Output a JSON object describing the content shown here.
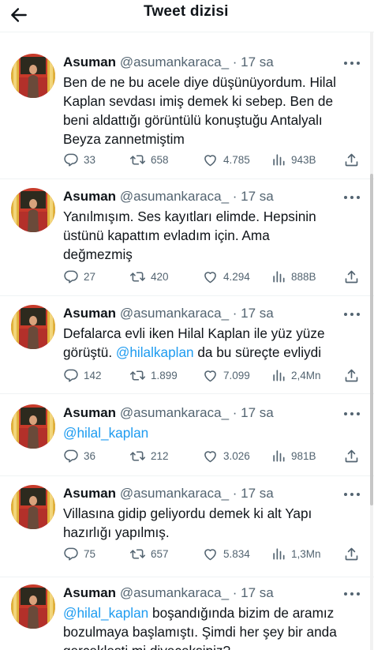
{
  "header": {
    "title": "Tweet dizisi"
  },
  "tweets": [
    {
      "name": "Asuman",
      "handle": "@asumankaraca_",
      "dot": "·",
      "time": "17 sa",
      "lines": [
        "Ben de ne bu acele diye düşünüyordum. Hilal",
        "Kaplan sevdası imiş demek ki sebep. Ben de",
        "beni aldattığı görüntülü konuştuğu Antalyalı",
        "Beyza zannetmiştim"
      ],
      "replies": "33",
      "retweets": "658",
      "likes": "4.785",
      "views": "943B"
    },
    {
      "name": "Asuman",
      "handle": "@asumankaraca_",
      "dot": "·",
      "time": "17 sa",
      "lines": [
        "Yanılmışım. Ses kayıtları elimde. Hepsinin",
        "üstünü kapattım evladım için. Ama",
        "değmezmiş"
      ],
      "replies": "27",
      "retweets": "420",
      "likes": "4.294",
      "views": "888B"
    },
    {
      "name": "Asuman",
      "handle": "@asumankaraca_",
      "dot": "·",
      "time": "17 sa",
      "line1": "Defalarca evli iken Hilal Kaplan ile yüz yüze",
      "line2_before": "görüştü. ",
      "mention": "@hilalkaplan",
      "line2_after": " da bu süreçte evliydi",
      "replies": "142",
      "retweets": "1.899",
      "likes": "7.099",
      "views": "2,4Mn"
    },
    {
      "name": "Asuman",
      "handle": "@asumankaraca_",
      "dot": "·",
      "time": "17 sa",
      "mention": "@hilal_kaplan",
      "replies": "36",
      "retweets": "212",
      "likes": "3.026",
      "views": "981B"
    },
    {
      "name": "Asuman",
      "handle": "@asumankaraca_",
      "dot": "·",
      "time": "17 sa",
      "lines": [
        "Villasına gidip geliyordu demek ki alt Yapı",
        "hazırlığı yapılmış."
      ],
      "replies": "75",
      "retweets": "657",
      "likes": "5.834",
      "views": "1,3Mn"
    },
    {
      "name": "Asuman",
      "handle": "@asumankaraca_",
      "dot": "·",
      "time": "17 sa",
      "mention": "@hilal_kaplan",
      "line1_after": " boşandığında bizim de aramız",
      "line2": "bozulmaya başlamıştı. Şimdi her şey bir anda",
      "line3": "gerçekleşti mi diyeceksiniz?"
    }
  ],
  "colors": {
    "text": "#0f1419",
    "secondary": "#536471",
    "link": "#1d9bf0",
    "divider": "#eff3f4"
  },
  "icons": [
    "back-arrow-icon",
    "more-icon",
    "reply-icon",
    "retweet-icon",
    "like-icon",
    "views-icon",
    "share-icon"
  ]
}
